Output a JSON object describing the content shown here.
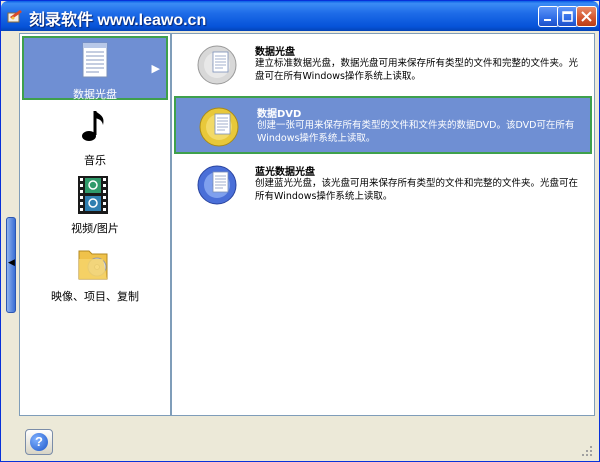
{
  "window": {
    "title": "刻录软件 www.leawo.cn",
    "app_icon": "burn-app-icon",
    "controls": [
      "minimize-icon",
      "maximize-icon",
      "close-icon"
    ]
  },
  "sidebar": {
    "items": [
      {
        "label": "数据光盘",
        "icon": "document-icon",
        "active": true
      },
      {
        "label": "音乐",
        "icon": "music-note-icon",
        "active": false
      },
      {
        "label": "视频/图片",
        "icon": "film-icon",
        "active": false
      },
      {
        "label": "映像、项目、复制",
        "icon": "folder-disc-icon",
        "active": false
      }
    ]
  },
  "options": {
    "items": [
      {
        "title": "数据光盘",
        "description": "建立标准数据光盘，数据光盘可用来保存所有类型的文件和完整的文件夹。光盘可在所有Windows操作系统上读取。",
        "disc": "cd-disc-icon",
        "selected": false
      },
      {
        "title": "数据DVD",
        "description": "创建一张可用来保存所有类型的文件和文件夹的数据DVD。该DVD可在所有Windows操作系统上读取。",
        "disc": "dvd-disc-icon",
        "selected": true
      },
      {
        "title": "蓝光数据光盘",
        "description": "创建蓝光光盘，该光盘可用来保存所有类型的文件和完整的文件夹。光盘可在所有Windows操作系统上读取。",
        "disc": "bluray-disc-icon",
        "selected": false
      }
    ]
  },
  "footer": {
    "help_label": "?"
  },
  "colors": {
    "title_bar": "#0653d9",
    "selection": "#6f8fd3",
    "selection_border": "#3fa04c",
    "window_bg": "#ece9d8"
  }
}
